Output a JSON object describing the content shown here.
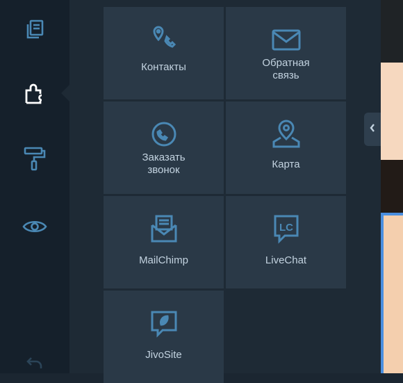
{
  "colors": {
    "rail_bg": "#15202b",
    "panel_bg": "#1e2a35",
    "tile_bg": "#2a3947",
    "icon_accent": "#4a88b4",
    "label_text": "#c3d3e0",
    "selection_border": "#4a8fe0"
  },
  "sidebar": {
    "items": [
      {
        "icon": "pages-icon"
      },
      {
        "icon": "puzzle-apps-icon",
        "active": true
      },
      {
        "icon": "paint-roller-icon"
      },
      {
        "icon": "eye-preview-icon"
      },
      {
        "icon": "undo-icon"
      }
    ]
  },
  "widgets": [
    {
      "id": "contacts",
      "label": "Контакты",
      "icon": "location-phone-icon"
    },
    {
      "id": "feedback",
      "label_line1": "Обратная",
      "label_line2": "связь",
      "icon": "envelope-icon"
    },
    {
      "id": "callback",
      "label_line1": "Заказать",
      "label_line2": "звонок",
      "icon": "phone-circle-icon"
    },
    {
      "id": "map",
      "label": "Карта",
      "icon": "map-pin-icon"
    },
    {
      "id": "mailchimp",
      "label": "MailChimp",
      "icon": "mail-letter-icon"
    },
    {
      "id": "livechat",
      "label": "LiveChat",
      "icon": "livechat-bubble-icon"
    },
    {
      "id": "jivosite",
      "label": "JivoSite",
      "icon": "jivosite-chat-icon"
    }
  ],
  "panel_toggle": {
    "icon": "chevron-left-icon"
  }
}
